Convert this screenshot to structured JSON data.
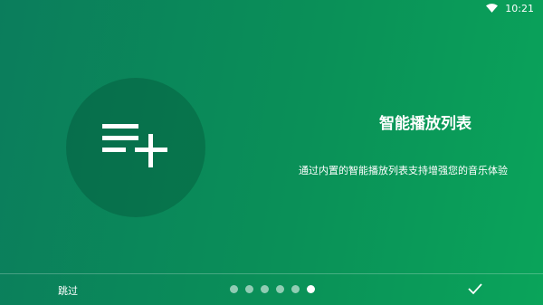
{
  "status_bar": {
    "time": "10:21",
    "icons": [
      "wifi-icon"
    ]
  },
  "slide": {
    "icon": "playlist-add-icon",
    "title": "智能播放列表",
    "description": "通过内置的智能播放列表支持增强您的音乐体验"
  },
  "bottom_bar": {
    "skip_label": "跳过",
    "page_count": 6,
    "current_page": 6,
    "done_icon": "check-icon"
  },
  "colors": {
    "background_start": "#0b7d5c",
    "background_end": "#0aa45a",
    "circle": "#0a6b4c"
  }
}
